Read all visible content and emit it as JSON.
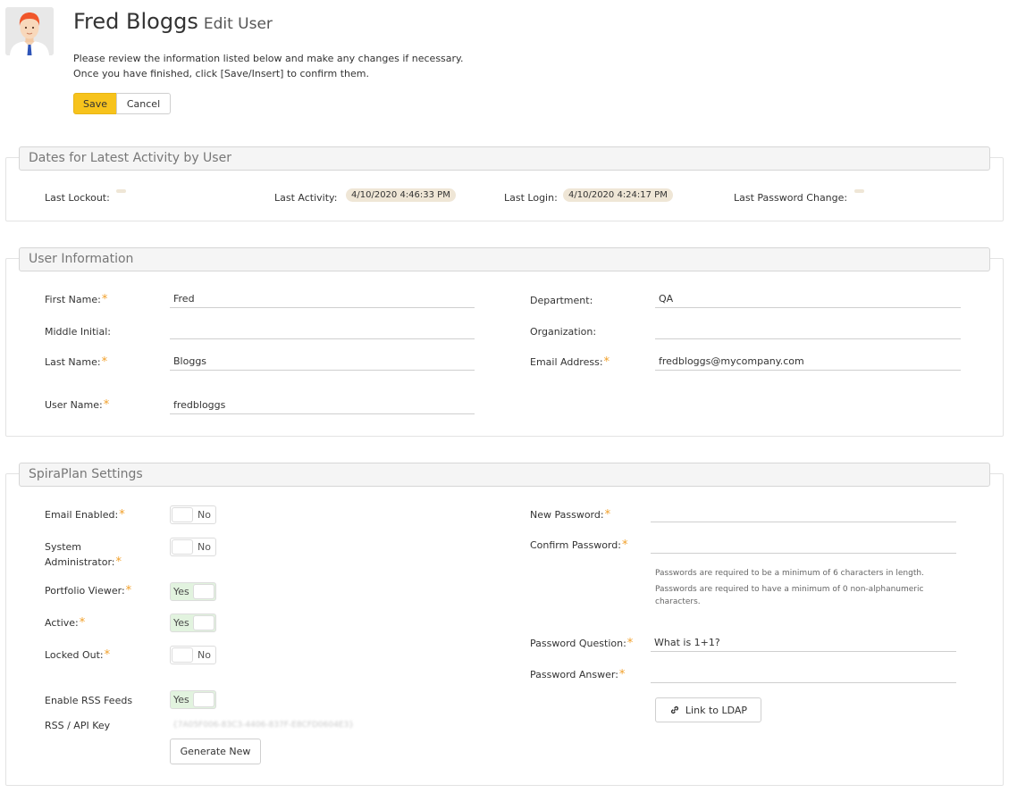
{
  "header": {
    "user_name": "Fred Bloggs",
    "subtitle": "Edit User",
    "intro_line1": "Please review the information listed below and make any changes if necessary.",
    "intro_line2": "Once you have finished, click [Save/Insert] to confirm them.",
    "save_label": "Save",
    "cancel_label": "Cancel",
    "avatar_icon": "user-avatar-icon"
  },
  "activity": {
    "legend": "Dates for Latest Activity by User",
    "last_lockout_label": "Last Lockout:",
    "last_lockout_value": "",
    "last_activity_label": "Last Activity:",
    "last_activity_value": "4/10/2020 4:46:33 PM",
    "last_login_label": "Last Login:",
    "last_login_value": "4/10/2020 4:24:17 PM",
    "last_password_change_label": "Last Password Change:",
    "last_password_change_value": ""
  },
  "user_info": {
    "legend": "User Information",
    "first_name_label": "First Name:",
    "first_name_value": "Fred",
    "middle_initial_label": "Middle Initial:",
    "middle_initial_value": "",
    "last_name_label": "Last Name:",
    "last_name_value": "Bloggs",
    "user_name_label": "User Name:",
    "user_name_value": "fredbloggs",
    "department_label": "Department:",
    "department_value": "QA",
    "organization_label": "Organization:",
    "organization_value": "",
    "email_label": "Email Address:",
    "email_value": "fredbloggs@mycompany.com",
    "required_mark": "*"
  },
  "settings": {
    "legend": "SpiraPlan Settings",
    "email_enabled_label": "Email Enabled:",
    "email_enabled_state": "No",
    "sysadmin_label_line1": "System",
    "sysadmin_label_line2": "Administrator:",
    "sysadmin_state": "No",
    "portfolio_viewer_label": "Portfolio Viewer:",
    "portfolio_viewer_state": "Yes",
    "active_label": "Active:",
    "active_state": "Yes",
    "locked_out_label": "Locked Out:",
    "locked_out_state": "No",
    "rss_label": "Enable RSS Feeds",
    "rss_state": "Yes",
    "api_key_label": "RSS / API Key",
    "api_key_value": "{7A05F006-83C3-4406-837F-E8CFD0604E3}",
    "generate_label": "Generate New",
    "new_password_label": "New Password:",
    "confirm_password_label": "Confirm Password:",
    "password_help1": "Passwords are required to be a minimum of 6 characters in length.",
    "password_help2_line1": "Passwords are required to have a minimum of 0 non-alphanumeric",
    "password_help2_line2": "characters.",
    "password_question_label": "Password Question:",
    "password_question_value": "What is 1+1?",
    "password_answer_label": "Password Answer:",
    "password_answer_value": "",
    "ldap_label": "Link to LDAP",
    "ldap_icon": "link-icon"
  },
  "colors": {
    "accent": "#f7c31c",
    "required": "#f1a02a",
    "toggle_on": "#e2f3df",
    "date_pill": "#efe6d6"
  }
}
